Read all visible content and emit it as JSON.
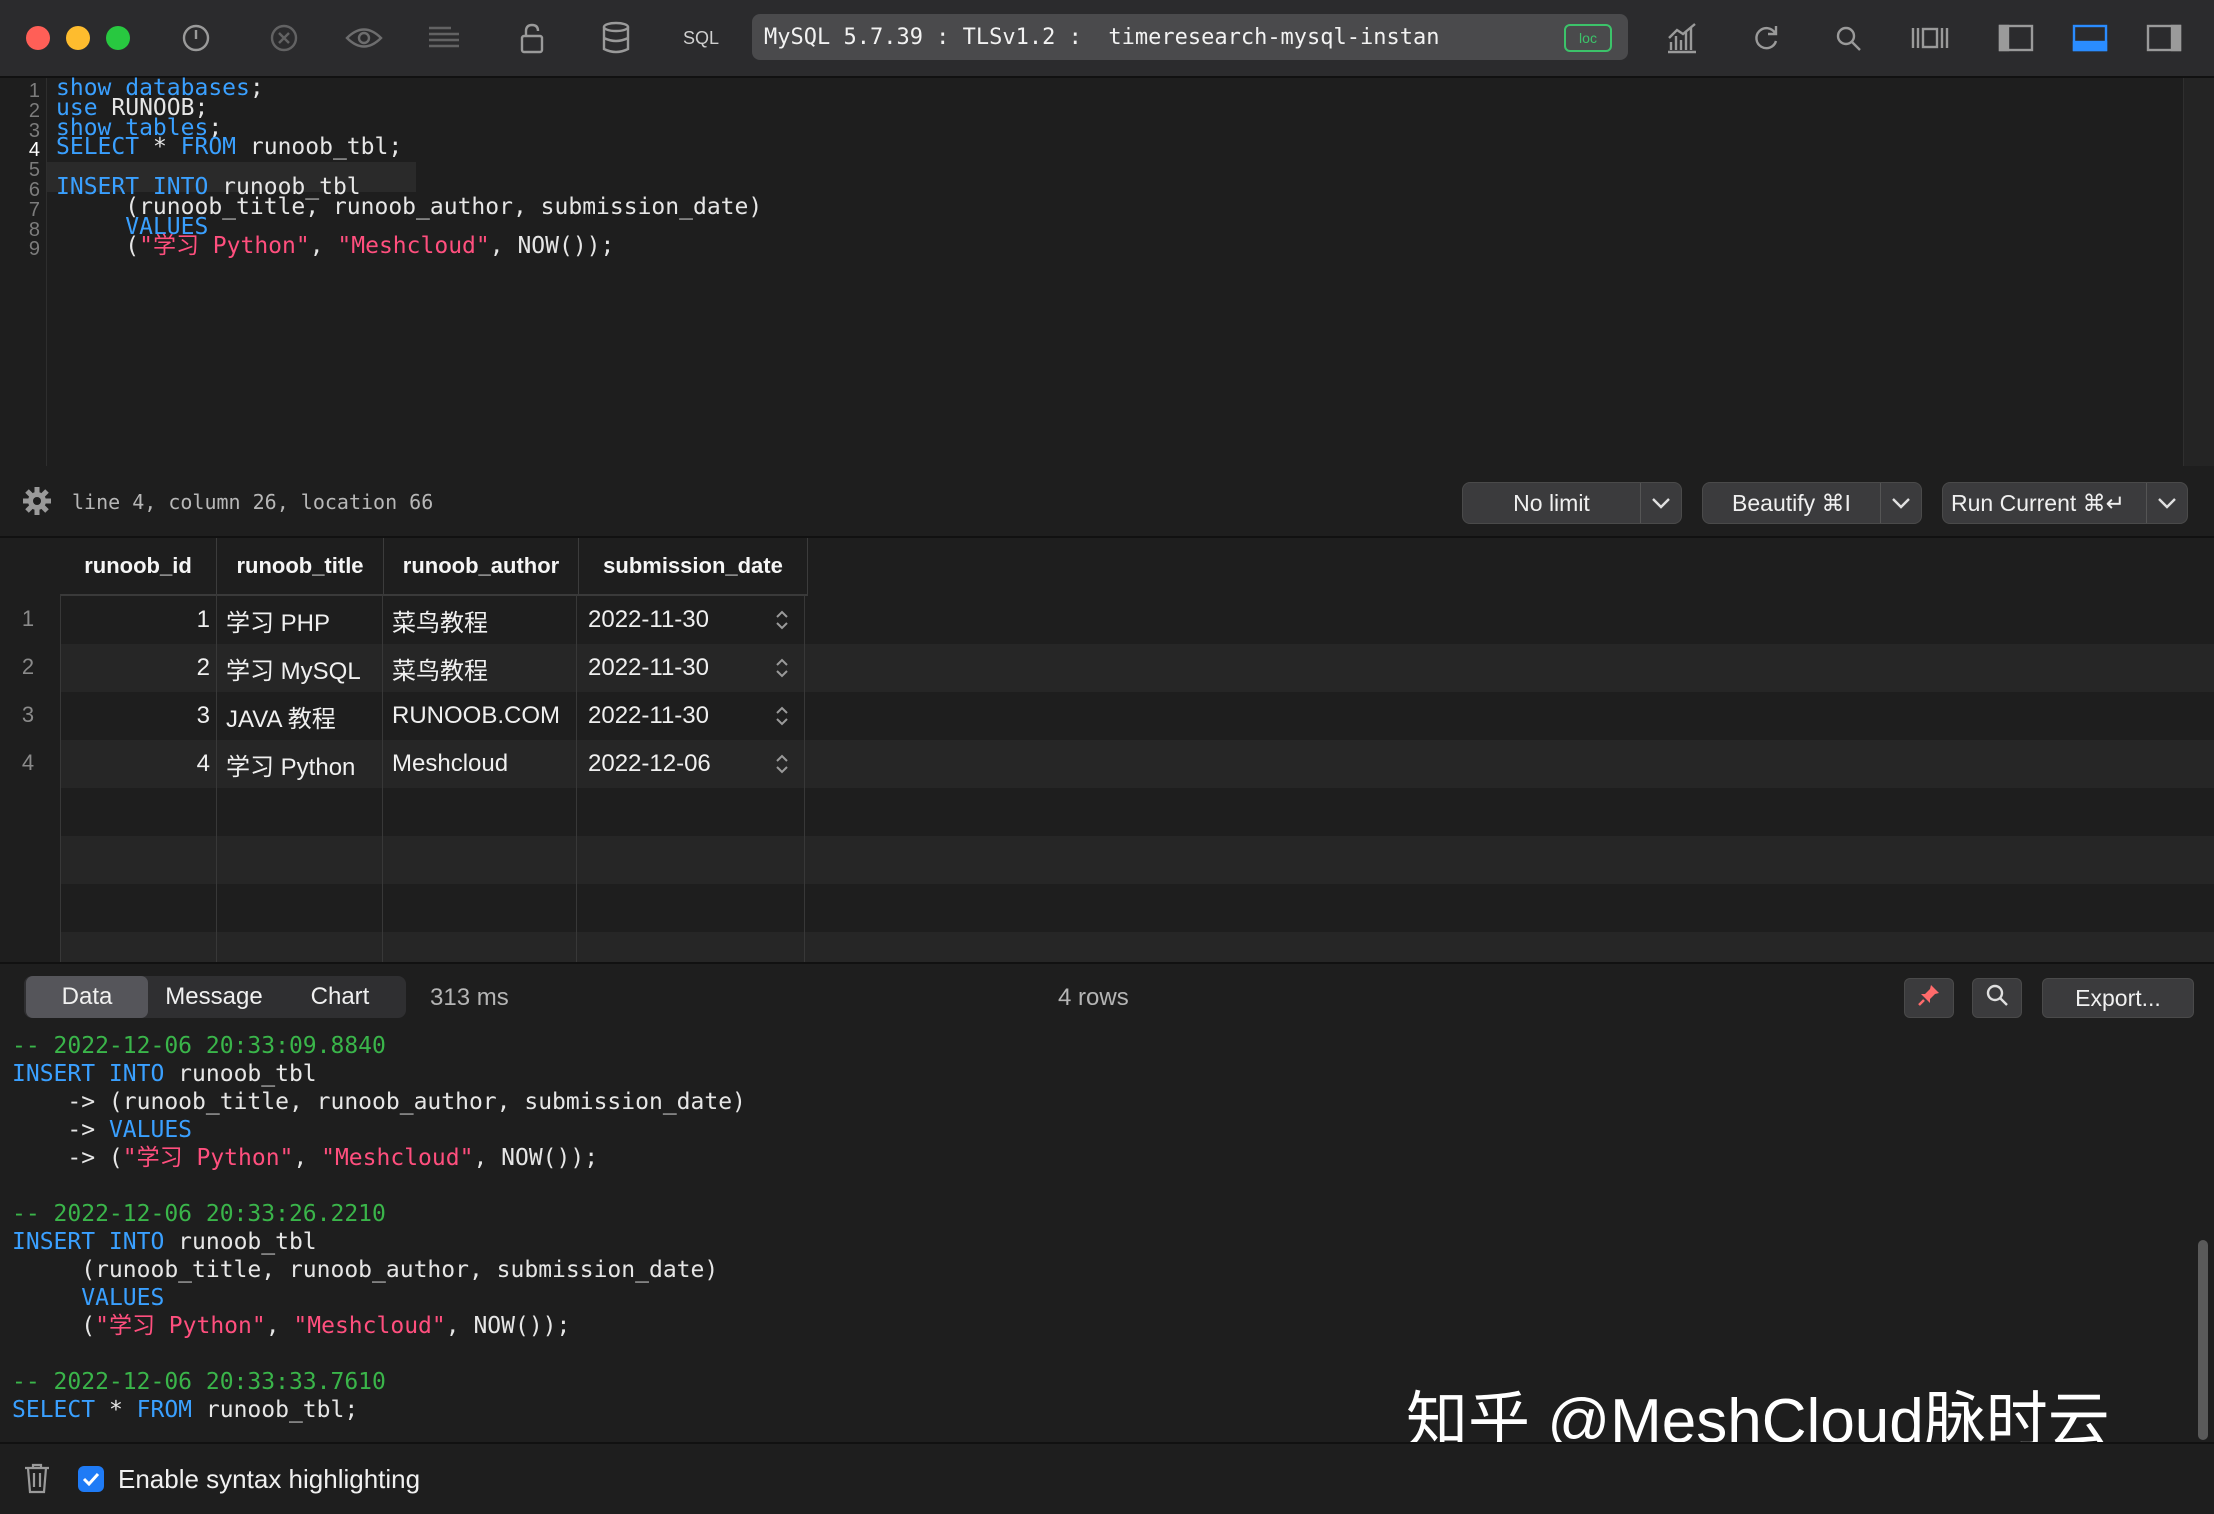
{
  "toolbar": {
    "sql_label": "SQL",
    "connection": "MySQL 5.7.39 : TLSv1.2 :  timeresearch-mysql-instan",
    "loc_badge": "loc"
  },
  "editor": {
    "line_numbers": [
      "1",
      "2",
      "3",
      "4",
      "5",
      "6",
      "7",
      "8",
      "9"
    ],
    "active_line": "4",
    "lines": [
      [
        {
          "t": "show databases",
          "c": "kw"
        },
        {
          "t": ";",
          "c": ""
        }
      ],
      [
        {
          "t": "use",
          "c": "kw"
        },
        {
          "t": " RUNOOB;",
          "c": ""
        }
      ],
      [
        {
          "t": "show tables",
          "c": "kw"
        },
        {
          "t": ";",
          "c": ""
        }
      ],
      [
        {
          "t": "SELECT",
          "c": "kw"
        },
        {
          "t": " * ",
          "c": ""
        },
        {
          "t": "FROM",
          "c": "kw"
        },
        {
          "t": " runoob_tbl;",
          "c": ""
        }
      ],
      [],
      [
        {
          "t": "INSERT INTO",
          "c": "kw"
        },
        {
          "t": " runoob_tbl",
          "c": ""
        }
      ],
      [
        {
          "t": "     (runoob_title, runoob_author, submission_date)",
          "c": ""
        }
      ],
      [
        {
          "t": "     ",
          "c": ""
        },
        {
          "t": "VALUES",
          "c": "kw"
        }
      ],
      [
        {
          "t": "     (",
          "c": ""
        },
        {
          "t": "\"学习 Python\"",
          "c": "str"
        },
        {
          "t": ", ",
          "c": ""
        },
        {
          "t": "\"Meshcloud\"",
          "c": "str"
        },
        {
          "t": ", NOW());",
          "c": ""
        }
      ]
    ]
  },
  "status": {
    "cursor_position": "line 4, column 26, location 66",
    "limit_label": "No limit",
    "beautify_label": "Beautify ⌘I",
    "run_label": "Run Current ⌘↵"
  },
  "table": {
    "columns": [
      "runoob_id",
      "runoob_title",
      "runoob_author",
      "submission_date"
    ],
    "rows": [
      {
        "num": "1",
        "id": "1",
        "title": "学习 PHP",
        "author": "菜鸟教程",
        "date": "2022-11-30"
      },
      {
        "num": "2",
        "id": "2",
        "title": "学习 MySQL",
        "author": "菜鸟教程",
        "date": "2022-11-30"
      },
      {
        "num": "3",
        "id": "3",
        "title": "JAVA 教程",
        "author": "RUNOOB.COM",
        "date": "2022-11-30"
      },
      {
        "num": "4",
        "id": "4",
        "title": "学习 Python",
        "author": "Meshcloud",
        "date": "2022-12-06"
      }
    ]
  },
  "results": {
    "tabs": [
      "Data",
      "Message",
      "Chart"
    ],
    "active_tab": "Data",
    "exec_time": "313 ms",
    "row_count": "4 rows",
    "export_label": "Export..."
  },
  "log": [
    [
      {
        "t": "-- 2022-12-06 20:33:09.8840",
        "c": "cm"
      }
    ],
    [
      {
        "t": "INSERT INTO",
        "c": "kw"
      },
      {
        "t": " runoob_tbl",
        "c": ""
      }
    ],
    [
      {
        "t": "    -> (runoob_title, runoob_author, submission_date)",
        "c": ""
      }
    ],
    [
      {
        "t": "    -> ",
        "c": ""
      },
      {
        "t": "VALUES",
        "c": "kw"
      }
    ],
    [
      {
        "t": "    -> (",
        "c": ""
      },
      {
        "t": "\"学习 Python\"",
        "c": "str"
      },
      {
        "t": ", ",
        "c": ""
      },
      {
        "t": "\"Meshcloud\"",
        "c": "str"
      },
      {
        "t": ", NOW());",
        "c": ""
      }
    ],
    [],
    [
      {
        "t": "-- 2022-12-06 20:33:26.2210",
        "c": "cm"
      }
    ],
    [
      {
        "t": "INSERT INTO",
        "c": "kw"
      },
      {
        "t": " runoob_tbl",
        "c": ""
      }
    ],
    [
      {
        "t": "     (runoob_title, runoob_author, submission_date)",
        "c": ""
      }
    ],
    [
      {
        "t": "     ",
        "c": ""
      },
      {
        "t": "VALUES",
        "c": "kw"
      }
    ],
    [
      {
        "t": "     (",
        "c": ""
      },
      {
        "t": "\"学习 Python\"",
        "c": "str"
      },
      {
        "t": ", ",
        "c": ""
      },
      {
        "t": "\"Meshcloud\"",
        "c": "str"
      },
      {
        "t": ", NOW());",
        "c": ""
      }
    ],
    [],
    [
      {
        "t": "-- 2022-12-06 20:33:33.7610",
        "c": "cm"
      }
    ],
    [
      {
        "t": "SELECT",
        "c": "kw"
      },
      {
        "t": " * ",
        "c": ""
      },
      {
        "t": "FROM",
        "c": "kw"
      },
      {
        "t": " runoob_tbl;",
        "c": ""
      }
    ]
  ],
  "watermark": "知乎 @MeshCloud脉时云",
  "bottom": {
    "syntax_highlight_label": "Enable syntax highlighting",
    "syntax_highlight_checked": true
  },
  "colors": {
    "keyword": "#3aa0ff",
    "string": "#ff4f7e",
    "comment": "#3ab54a",
    "accent": "#1f7bf6",
    "close": "#ff5f57",
    "minimize": "#febc2e",
    "zoom": "#28c840"
  }
}
